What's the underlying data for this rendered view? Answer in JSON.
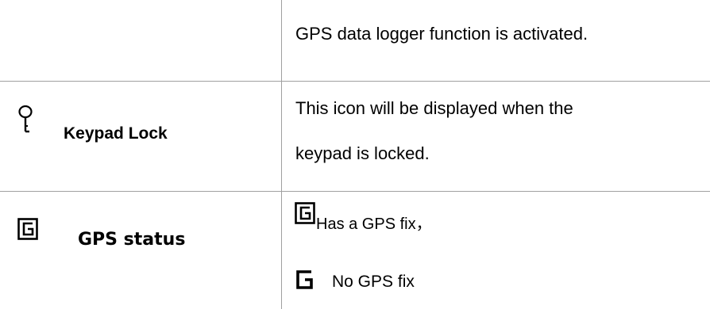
{
  "rows": [
    {
      "label": "",
      "description_lines": [
        "GPS data logger function is activated."
      ]
    },
    {
      "icon": "key-icon",
      "label": "Keypad Lock",
      "description_lines": [
        "This icon will be displayed when the",
        "keypad is locked."
      ]
    },
    {
      "icon": "gps-g-box-icon",
      "label": "GPS status",
      "states": [
        {
          "icon": "gps-g-box-icon",
          "text": "Has a GPS fix，"
        },
        {
          "icon": "gps-g-plain-icon",
          "text": "No GPS fix"
        }
      ]
    }
  ],
  "colors": {
    "grid": "#a0a0a0",
    "text": "#000000",
    "background": "#ffffff"
  }
}
